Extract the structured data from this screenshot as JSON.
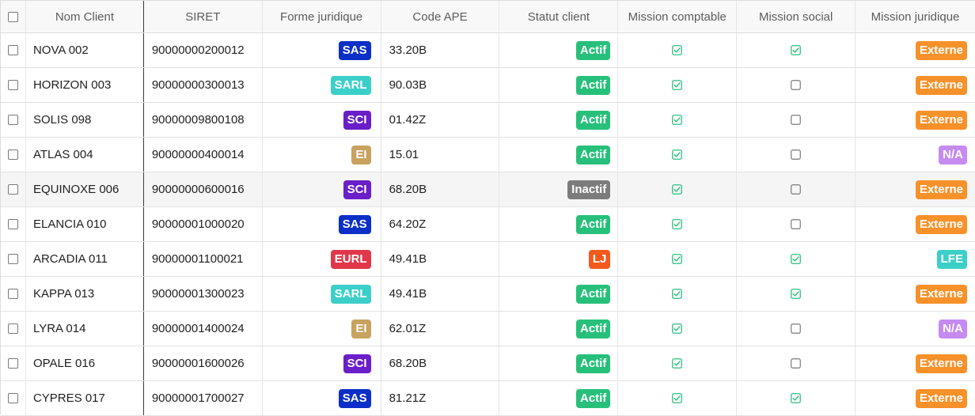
{
  "table": {
    "headers": [
      "Nom Client",
      "SIRET",
      "Forme juridique",
      "Code APE",
      "Statut client",
      "Mission comptable",
      "Mission social",
      "Mission juridique"
    ],
    "rows": [
      {
        "nom": "NOVA 002",
        "siret": "90000000200012",
        "forme": "SAS",
        "ape": "33.20B",
        "statut": "Actif",
        "compta": true,
        "social": true,
        "juridique": "Externe"
      },
      {
        "nom": "HORIZON 003",
        "siret": "90000000300013",
        "forme": "SARL",
        "ape": "90.03B",
        "statut": "Actif",
        "compta": true,
        "social": false,
        "juridique": "Externe"
      },
      {
        "nom": "SOLIS 098",
        "siret": "90000009800108",
        "forme": "SCI",
        "ape": "01.42Z",
        "statut": "Actif",
        "compta": true,
        "social": false,
        "juridique": "Externe"
      },
      {
        "nom": "ATLAS 004",
        "siret": "90000000400014",
        "forme": "EI",
        "ape": "15.01",
        "statut": "Actif",
        "compta": true,
        "social": false,
        "juridique": "N/A"
      },
      {
        "nom": "EQUINOXE 006",
        "siret": "90000000600016",
        "forme": "SCI",
        "ape": "68.20B",
        "statut": "Inactif",
        "compta": true,
        "social": false,
        "juridique": "Externe"
      },
      {
        "nom": "ELANCIA 010",
        "siret": "90000001000020",
        "forme": "SAS",
        "ape": "64.20Z",
        "statut": "Actif",
        "compta": true,
        "social": false,
        "juridique": "Externe"
      },
      {
        "nom": "ARCADIA 011",
        "siret": "90000001100021",
        "forme": "EURL",
        "ape": "49.41B",
        "statut": "LJ",
        "compta": true,
        "social": true,
        "juridique": "LFE"
      },
      {
        "nom": "KAPPA 013",
        "siret": "90000001300023",
        "forme": "SARL",
        "ape": "49.41B",
        "statut": "Actif",
        "compta": true,
        "social": true,
        "juridique": "Externe"
      },
      {
        "nom": "LYRA 014",
        "siret": "90000001400024",
        "forme": "EI",
        "ape": "62.01Z",
        "statut": "Actif",
        "compta": true,
        "social": false,
        "juridique": "N/A"
      },
      {
        "nom": "OPALE 016",
        "siret": "90000001600026",
        "forme": "SCI",
        "ape": "68.20B",
        "statut": "Actif",
        "compta": true,
        "social": false,
        "juridique": "Externe"
      },
      {
        "nom": "CYPRES 017",
        "siret": "90000001700027",
        "forme": "SAS",
        "ape": "81.21Z",
        "statut": "Actif",
        "compta": true,
        "social": true,
        "juridique": "Externe"
      }
    ]
  },
  "colors": {
    "check_green": "#2fbf7f",
    "unchecked_border": "#7a7a7a"
  }
}
